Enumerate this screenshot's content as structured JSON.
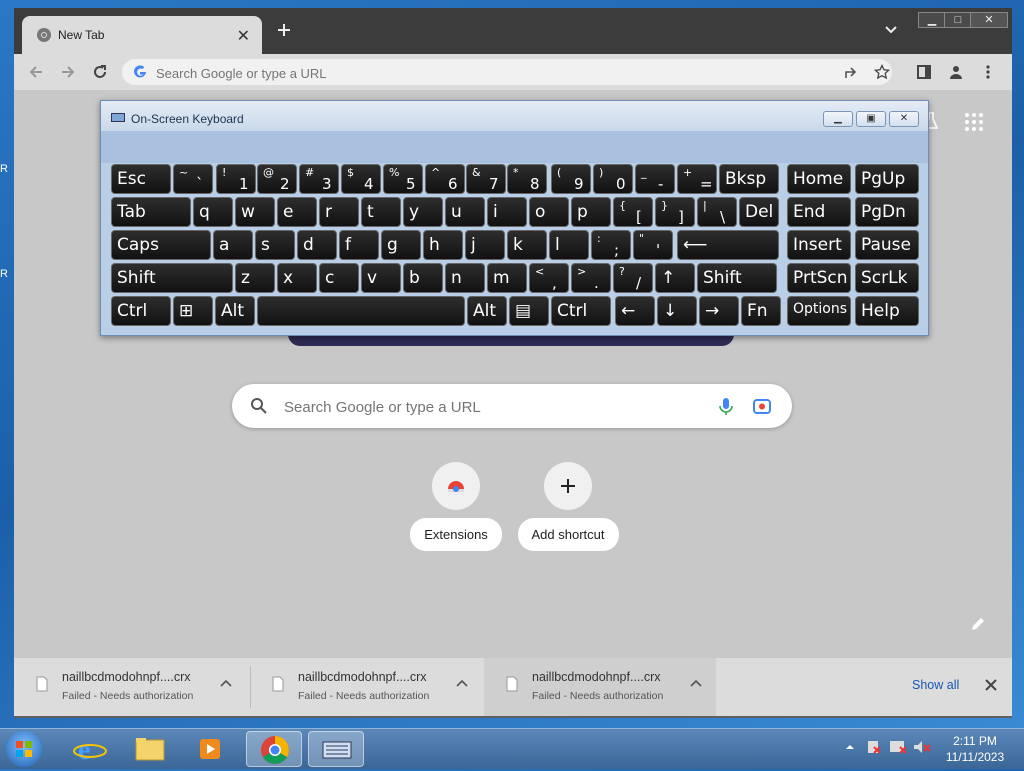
{
  "browser": {
    "tab_title": "New Tab",
    "omnibox_placeholder": "Search Google or type a URL",
    "window_controls": {
      "minimize": "▁",
      "maximize": "□",
      "close": "✕"
    }
  },
  "ntp": {
    "search_placeholder": "Search Google or type a URL",
    "shortcuts": [
      {
        "label": "Extensions"
      },
      {
        "label": "Add shortcut"
      }
    ]
  },
  "downloads": {
    "items": [
      {
        "name": "naillbcdmodohnpf....crx",
        "status": "Failed - Needs authorization"
      },
      {
        "name": "naillbcdmodohnpf....crx",
        "status": "Failed - Needs authorization"
      },
      {
        "name": "naillbcdmodohnpf....crx",
        "status": "Failed - Needs authorization"
      }
    ],
    "show_all": "Show all"
  },
  "osk": {
    "title": "On-Screen Keyboard",
    "rows": [
      [
        {
          "main": "Esc"
        },
        {
          "sup": "~",
          "sub": "`"
        },
        {
          "sup": "!",
          "sub": "1"
        },
        {
          "sup": "@",
          "sub": "2"
        },
        {
          "sup": "#",
          "sub": "3"
        },
        {
          "sup": "$",
          "sub": "4"
        },
        {
          "sup": "%",
          "sub": "5"
        },
        {
          "sup": "^",
          "sub": "6"
        },
        {
          "sup": "&",
          "sub": "7"
        },
        {
          "sup": "*",
          "sub": "8"
        },
        {
          "sup": "(",
          "sub": "9"
        },
        {
          "sup": ")",
          "sub": "0"
        },
        {
          "sup": "_",
          "sub": "-"
        },
        {
          "sup": "+",
          "sub": "="
        },
        {
          "main": "Bksp"
        },
        {
          "main": "Home"
        },
        {
          "main": "PgUp"
        }
      ],
      [
        {
          "main": "Tab"
        },
        {
          "main": "q"
        },
        {
          "main": "w"
        },
        {
          "main": "e"
        },
        {
          "main": "r"
        },
        {
          "main": "t"
        },
        {
          "main": "y"
        },
        {
          "main": "u"
        },
        {
          "main": "i"
        },
        {
          "main": "o"
        },
        {
          "main": "p"
        },
        {
          "sup": "{",
          "sub": "["
        },
        {
          "sup": "}",
          "sub": "]"
        },
        {
          "sup": "|",
          "sub": "\\"
        },
        {
          "main": "Del"
        },
        {
          "main": "End"
        },
        {
          "main": "PgDn"
        }
      ],
      [
        {
          "main": "Caps"
        },
        {
          "main": "a"
        },
        {
          "main": "s"
        },
        {
          "main": "d"
        },
        {
          "main": "f"
        },
        {
          "main": "g"
        },
        {
          "main": "h"
        },
        {
          "main": "j"
        },
        {
          "main": "k"
        },
        {
          "main": "l"
        },
        {
          "sup": ":",
          "sub": ";"
        },
        {
          "sup": "\"",
          "sub": "'"
        },
        {
          "main": "⟵"
        },
        {
          "main": "Insert"
        },
        {
          "main": "Pause"
        }
      ],
      [
        {
          "main": "Shift"
        },
        {
          "main": "z"
        },
        {
          "main": "x"
        },
        {
          "main": "c"
        },
        {
          "main": "v"
        },
        {
          "main": "b"
        },
        {
          "main": "n"
        },
        {
          "main": "m"
        },
        {
          "sup": "<",
          "sub": ","
        },
        {
          "sup": ">",
          "sub": "."
        },
        {
          "sup": "?",
          "sub": "/"
        },
        {
          "main": "↑"
        },
        {
          "main": "Shift"
        },
        {
          "main": "PrtScn"
        },
        {
          "main": "ScrLk"
        }
      ],
      [
        {
          "main": "Ctrl"
        },
        {
          "main": "⊞"
        },
        {
          "main": "Alt"
        },
        {
          "main": ""
        },
        {
          "main": "Alt"
        },
        {
          "main": "▤"
        },
        {
          "main": "Ctrl"
        },
        {
          "main": "←"
        },
        {
          "main": "↓"
        },
        {
          "main": "→"
        },
        {
          "main": "Fn"
        },
        {
          "main": "Options"
        },
        {
          "main": "Help"
        }
      ]
    ]
  },
  "desktop": {
    "edge_letters": [
      "R",
      "R"
    ]
  },
  "taskbar": {
    "time": "2:11 PM",
    "date": "11/11/2023"
  }
}
